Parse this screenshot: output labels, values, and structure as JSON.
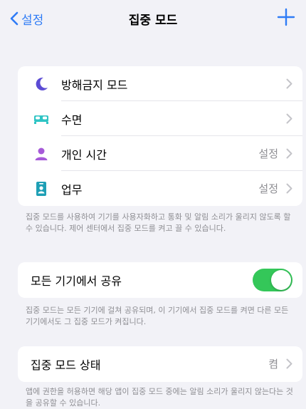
{
  "nav": {
    "back_label": "설정",
    "title": "집중 모드"
  },
  "modes": [
    {
      "label": "방해금지 모드",
      "value": "",
      "icon": "moon-icon",
      "icon_color": "#5b4bd4"
    },
    {
      "label": "수면",
      "value": "",
      "icon": "bed-icon",
      "icon_color": "#2ec4c4"
    },
    {
      "label": "개인 시간",
      "value": "설정",
      "icon": "person-icon",
      "icon_color": "#a65ad8"
    },
    {
      "label": "업무",
      "value": "설정",
      "icon": "id-badge-icon",
      "icon_color": "#1e9fb5"
    }
  ],
  "modes_note": "집중 모드를 사용하여 기기를 사용자화하고 통화 및 알림 소리가 울리지 않도록 할 수 있습니다. 제어 센터에서 집중 모드를 켜고 끌 수 있습니다.",
  "share": {
    "label": "모든 기기에서 공유",
    "enabled": true,
    "accent": "#34c759"
  },
  "share_note": "집중 모드는 모든 기기에 걸쳐 공유되며, 이 기기에서 집중 모드를 켜면 다른 모든 기기에서도 그 집중 모드가 켜집니다.",
  "status": {
    "label": "집중 모드 상태",
    "value": "켬"
  },
  "status_note": "앱에 권한을 허용하면 해당 앱이 집중 모드 중에는 알림 소리가 울리지 않는다는 것을 공유할 수 있습니다."
}
